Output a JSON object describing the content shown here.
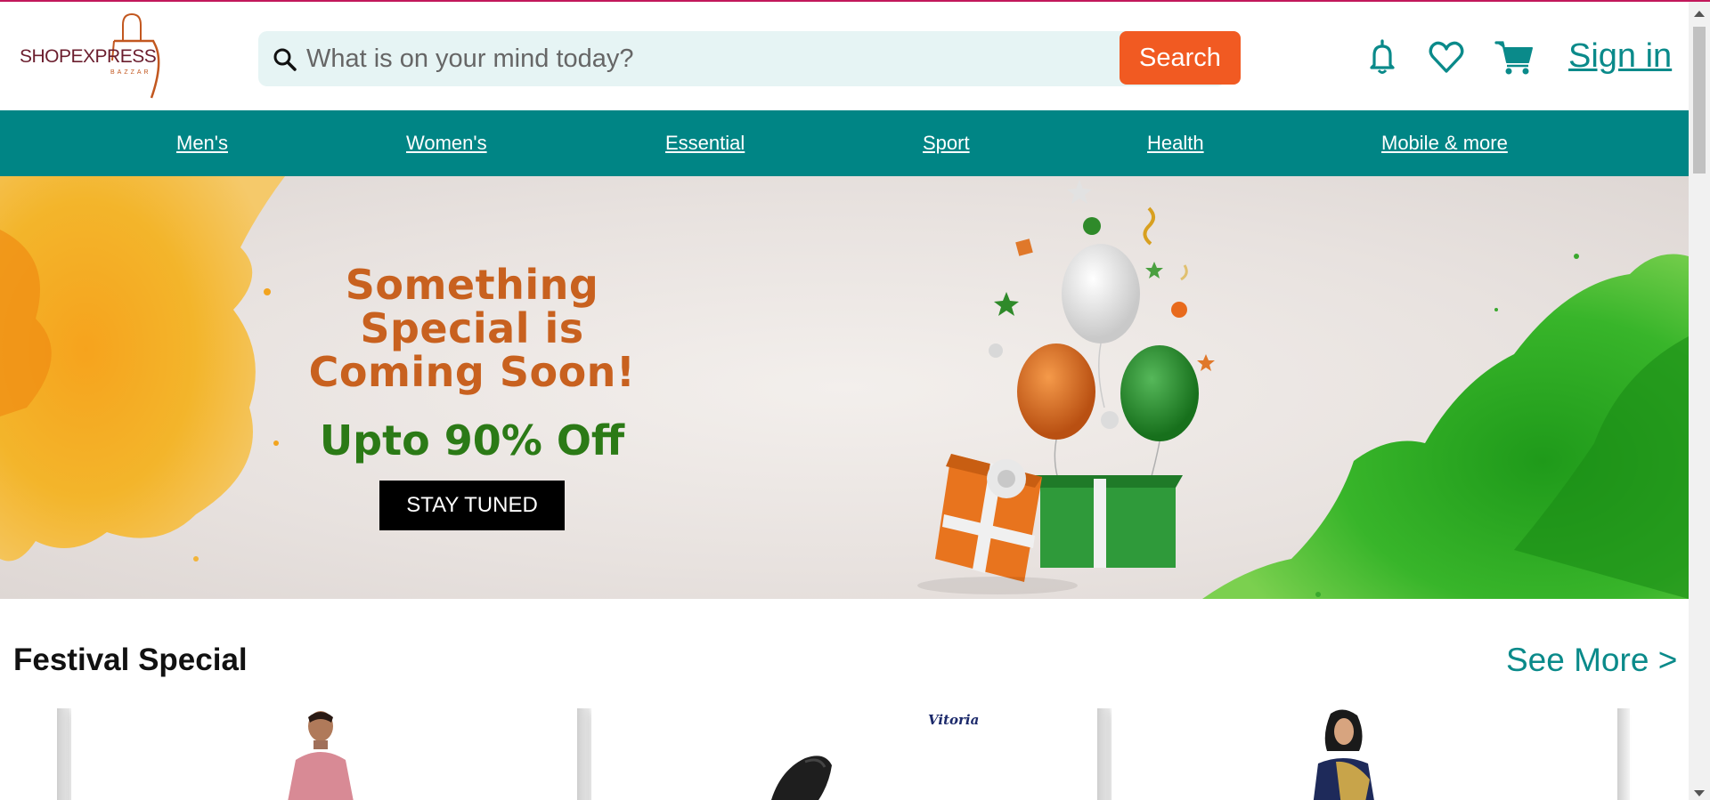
{
  "logo": {
    "name": "SHOPEXPRESS",
    "sub": "BAZZAR"
  },
  "search": {
    "placeholder": "What is on your mind today?",
    "button_label": "Search"
  },
  "header": {
    "icons": [
      "bell-icon",
      "heart-icon",
      "cart-icon"
    ],
    "signin_label": "Sign in"
  },
  "nav": {
    "items": [
      {
        "label": "Men's"
      },
      {
        "label": "Women's"
      },
      {
        "label": "Essential"
      },
      {
        "label": "Sport"
      },
      {
        "label": "Health"
      },
      {
        "label": "Mobile & more"
      }
    ]
  },
  "banner": {
    "title": "Something Special is Coming Soon!",
    "offer": "Upto 90% Off",
    "button_label": "STAY TUNED"
  },
  "section": {
    "title": "Festival Special",
    "see_more": "See More >",
    "cards": [
      {
        "image": "man-kurta-product"
      },
      {
        "image": "heel-shoe-product",
        "brand": "Vitoria"
      },
      {
        "image": "saree-product"
      }
    ]
  },
  "colors": {
    "accent_teal": "#008585",
    "search_button": "#f15a22",
    "banner_title": "#c8611f",
    "banner_offer": "#2b7a16",
    "top_border": "#c2185b"
  }
}
